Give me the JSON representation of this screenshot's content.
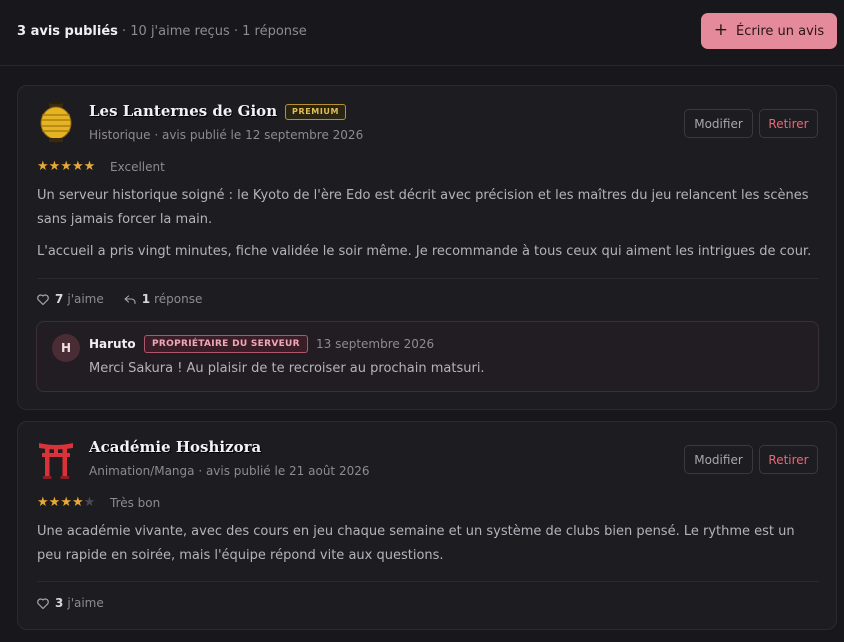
{
  "summary": {
    "published": "3 avis publiés",
    "likes_received": " · 10 j'aime reçus",
    "replies": " · 1 réponse"
  },
  "actions": {
    "write_review": "Écrire un avis"
  },
  "colors": {
    "accent": "#e48a9b",
    "star": "#e8a838",
    "danger": "#e66a76",
    "premium": "#e3be57"
  },
  "reviews": [
    {
      "server_name": "Les Lanternes de Gion",
      "badge": "PREMIUM",
      "meta": "Historique · avis publié le 12 septembre 2026",
      "rating": 5,
      "rating_max": 5,
      "rating_label": "Excellent",
      "paragraphs": [
        "Un serveur historique soigné : le Kyoto de l'ère Edo est décrit avec précision et les maîtres du jeu relancent les scènes sans jamais forcer la main.",
        "L'accueil a pris vingt minutes, fiche validée le soir même. Je recommande à tous ceux qui aiment les intrigues de cour."
      ],
      "likes": "7",
      "likes_label": "j'aime",
      "reply_count": "1",
      "reply_label": "réponse",
      "edit_label": "Modifier",
      "remove_label": "Retirer",
      "icon": "lantern-icon",
      "reply": {
        "avatar_initial": "H",
        "author": "Haruto",
        "badge": "PROPRIÉTAIRE DU SERVEUR",
        "date": "13 septembre 2026",
        "text": "Merci Sakura ! Au plaisir de te recroiser au prochain matsuri."
      }
    },
    {
      "server_name": "Académie Hoshizora",
      "meta": "Animation/Manga · avis publié le 21 août 2026",
      "rating": 4,
      "rating_max": 5,
      "rating_label": "Très bon",
      "paragraphs": [
        "Une académie vivante, avec des cours en jeu chaque semaine et un système de clubs bien pensé. Le rythme est un peu rapide en soirée, mais l'équipe répond vite aux questions."
      ],
      "likes": "3",
      "likes_label": "j'aime",
      "edit_label": "Modifier",
      "remove_label": "Retirer",
      "icon": "torii-gate-icon"
    }
  ]
}
